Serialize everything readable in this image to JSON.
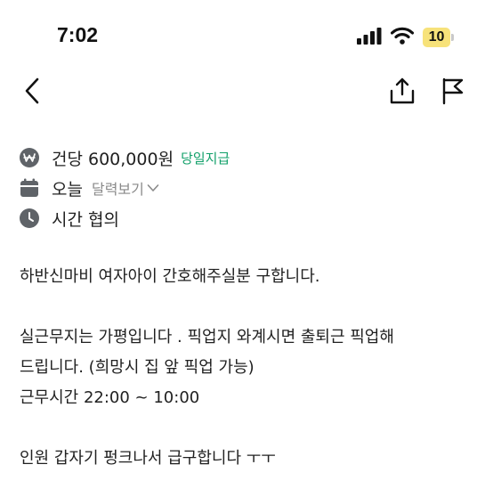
{
  "status_bar": {
    "time": "7:02",
    "battery_level": "10"
  },
  "job": {
    "pay": "건당 600,000원",
    "pay_tag": "당일지급",
    "date": "오늘",
    "calendar_link": "달력보기",
    "hours": "시간 협의"
  },
  "description": {
    "line1": "하반신마비 여자아이 간호해주실분 구합니다.",
    "line2": "실근무지는 가평입니다 . 픽업지 와계시면 출퇴근 픽업해",
    "line3": "드립니다. (희망시 집 앞 픽업 가능)",
    "line4": "근무시간 22:00 ~ 10:00",
    "line5": "인원 갑자기 펑크나서 급구합니다 ㅜㅜ"
  },
  "colors": {
    "accent_green": "#12a06a",
    "icon_gray": "#5f6368",
    "battery_yellow": "#f7e27a"
  }
}
